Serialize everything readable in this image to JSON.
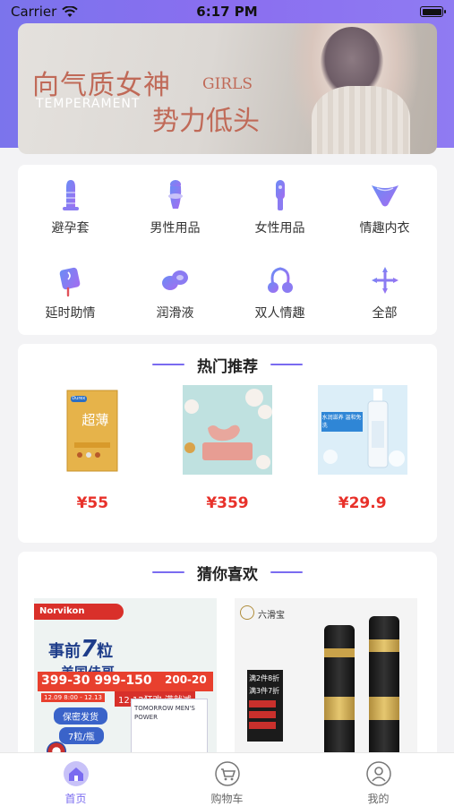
{
  "status_bar": {
    "carrier": "Carrier",
    "time": "6:17 PM"
  },
  "banner": {
    "slogan_line1": "向气质女神",
    "slogan_line2": "势力低头",
    "english_1": "GIRLS",
    "english_2": "TEMPERAMENT"
  },
  "categories": [
    {
      "label": "避孕套",
      "icon": "condom-icon"
    },
    {
      "label": "男性用品",
      "icon": "male-product-icon"
    },
    {
      "label": "女性用品",
      "icon": "female-product-icon"
    },
    {
      "label": "情趣内衣",
      "icon": "lingerie-icon"
    },
    {
      "label": "延时助情",
      "icon": "delay-spray-icon"
    },
    {
      "label": "润滑液",
      "icon": "lubricant-icon"
    },
    {
      "label": "双人情趣",
      "icon": "couple-toy-icon"
    },
    {
      "label": "全部",
      "icon": "all-categories-icon"
    }
  ],
  "hot_section": {
    "title": "热门推荐",
    "items": [
      {
        "price": "¥55",
        "image": "condom-box-image",
        "brand": "Durex",
        "name": "超薄"
      },
      {
        "price": "¥359",
        "image": "pink-toy-image"
      },
      {
        "price": "¥29.9",
        "image": "lubricant-bottle-image",
        "text": "水润滋养 温和免洗"
      }
    ]
  },
  "like_section": {
    "title": "猜你喜欢",
    "items": [
      {
        "image": "supplement-ad-image",
        "brand": "Norvikon",
        "headline_1": "事前",
        "headline_num": "7",
        "headline_2": "粒",
        "line2": "美国佳哥",
        "promo": "399-30 999-150",
        "promo2": "200-20",
        "date": "12.09 8:00 - 12.13",
        "event": "12.12狂欢 满就减",
        "tag1": "保密发货",
        "tag2": "7粒/瓶",
        "box_text": "TOMORROW MEN'S POWER"
      },
      {
        "image": "black-spray-image",
        "brand": "六滑宝",
        "promo1": "满2件8折",
        "promo2": "满3件7折"
      }
    ]
  },
  "tab_bar": {
    "tabs": [
      {
        "label": "首页",
        "icon": "home-icon",
        "active": true
      },
      {
        "label": "购物车",
        "icon": "cart-icon",
        "active": false
      },
      {
        "label": "我的",
        "icon": "profile-icon",
        "active": false
      }
    ]
  },
  "colors": {
    "accent": "#7a6bf0",
    "price": "#e8312a",
    "icon_gradient_start": "#6a8cf5",
    "icon_gradient_end": "#a56cf0"
  }
}
